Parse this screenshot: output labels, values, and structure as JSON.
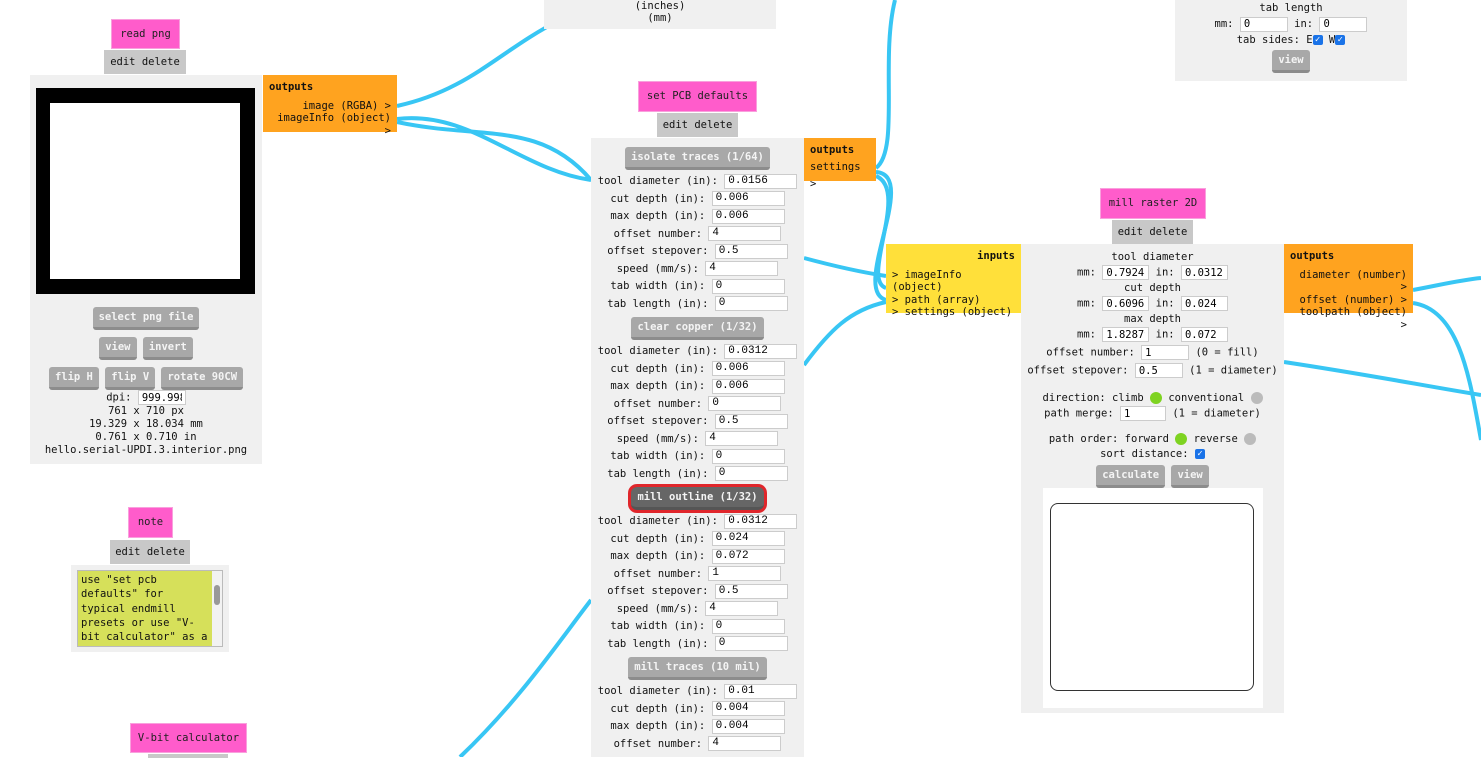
{
  "colors": {
    "wire": "#38c6f4",
    "title": "#ff5ccb",
    "outputs": "#ffa31f",
    "inputs": "#ffe03a",
    "active": "#7ed321",
    "inactive": "#bbbbbb",
    "note_bg": "#d6e05a",
    "highlight": "#e0262b"
  },
  "common": {
    "edit": "edit",
    "delete": "delete",
    "outputs": "outputs",
    "inputs": "inputs"
  },
  "top_partial": {
    "line1": "(inches)",
    "line2": "(mm)"
  },
  "top_right": {
    "tab_length": "tab length",
    "mm_label": "mm:",
    "mm_value": "0",
    "in_label": "in:",
    "in_value": "0",
    "tab_sides": "tab sides: E",
    "w_label": "W",
    "view": "view"
  },
  "read_png": {
    "title": "read png",
    "outputs": [
      "image (RGBA) >",
      "imageInfo (object) >"
    ],
    "select_button": "select png file",
    "view": "view",
    "invert": "invert",
    "flip_h": "flip H",
    "flip_v": "flip V",
    "rotate": "rotate 90CW",
    "dpi_label": "dpi:",
    "dpi_value": "999.998",
    "px": "761 x 710 px",
    "mm": "19.329 x 18.034 mm",
    "in": "0.761 x 0.710 in",
    "filename": "hello.serial-UPDI.3.interior.png"
  },
  "note": {
    "title": "note",
    "text": "use \"set pcb defaults\" for typical endmill presets or use \"V-bit calculator\" as a"
  },
  "vbit": {
    "title": "V-bit calculator"
  },
  "pcb_defaults": {
    "title": "set PCB defaults",
    "outputs": [
      "settings >"
    ],
    "sections": [
      {
        "button": "isolate traces (1/64)",
        "rows": [
          [
            "tool diameter (in):",
            "0.0156"
          ],
          [
            "cut depth (in):",
            "0.006"
          ],
          [
            "max depth (in):",
            "0.006"
          ],
          [
            "offset number:",
            "4"
          ],
          [
            "offset stepover:",
            "0.5"
          ],
          [
            "speed (mm/s):",
            "4"
          ],
          [
            "tab width (in):",
            "0"
          ],
          [
            "tab length (in):",
            "0"
          ]
        ]
      },
      {
        "button": "clear copper (1/32)",
        "rows": [
          [
            "tool diameter (in):",
            "0.0312"
          ],
          [
            "cut depth (in):",
            "0.006"
          ],
          [
            "max depth (in):",
            "0.006"
          ],
          [
            "offset number:",
            "0"
          ],
          [
            "offset stepover:",
            "0.5"
          ],
          [
            "speed (mm/s):",
            "4"
          ],
          [
            "tab width (in):",
            "0"
          ],
          [
            "tab length (in):",
            "0"
          ]
        ]
      },
      {
        "button": "mill outline (1/32)",
        "selected": true,
        "rows": [
          [
            "tool diameter (in):",
            "0.0312"
          ],
          [
            "cut depth (in):",
            "0.024"
          ],
          [
            "max depth (in):",
            "0.072"
          ],
          [
            "offset number:",
            "1"
          ],
          [
            "offset stepover:",
            "0.5"
          ],
          [
            "speed (mm/s):",
            "4"
          ],
          [
            "tab width (in):",
            "0"
          ],
          [
            "tab length (in):",
            "0"
          ]
        ]
      },
      {
        "button": "mill traces (10 mil)",
        "rows": [
          [
            "tool diameter (in):",
            "0.01"
          ],
          [
            "cut depth (in):",
            "0.004"
          ],
          [
            "max depth (in):",
            "0.004"
          ],
          [
            "offset number:",
            "4"
          ]
        ]
      }
    ]
  },
  "mill_raster": {
    "title": "mill raster 2D",
    "inputs": [
      "> imageInfo (object)",
      "> path (array)",
      "> settings (object)"
    ],
    "outputs": [
      "diameter (number) >",
      "offset (number) >",
      "toolpath (object) >"
    ],
    "tool_diameter": "tool diameter",
    "td_mm": "0.79248",
    "td_in": "0.0312",
    "cut_depth": "cut depth",
    "cd_mm": "0.6096",
    "cd_in": "0.024",
    "max_depth": "max depth",
    "md_mm": "1.82879",
    "md_in": "0.072",
    "mm_label": "mm:",
    "in_label": "in:",
    "offset_number_label": "offset number:",
    "offset_number": "1",
    "offset_number_hint": "(0 = fill)",
    "offset_stepover_label": "offset stepover:",
    "offset_stepover": "0.5",
    "offset_stepover_hint": "(1 = diameter)",
    "direction_label": "direction: climb",
    "conventional": "conventional",
    "path_merge_label": "path merge:",
    "path_merge": "1",
    "path_merge_hint": "(1 = diameter)",
    "path_order_label": "path order: forward",
    "reverse": "reverse",
    "sort_distance": "sort distance:",
    "calculate": "calculate",
    "view": "view"
  }
}
